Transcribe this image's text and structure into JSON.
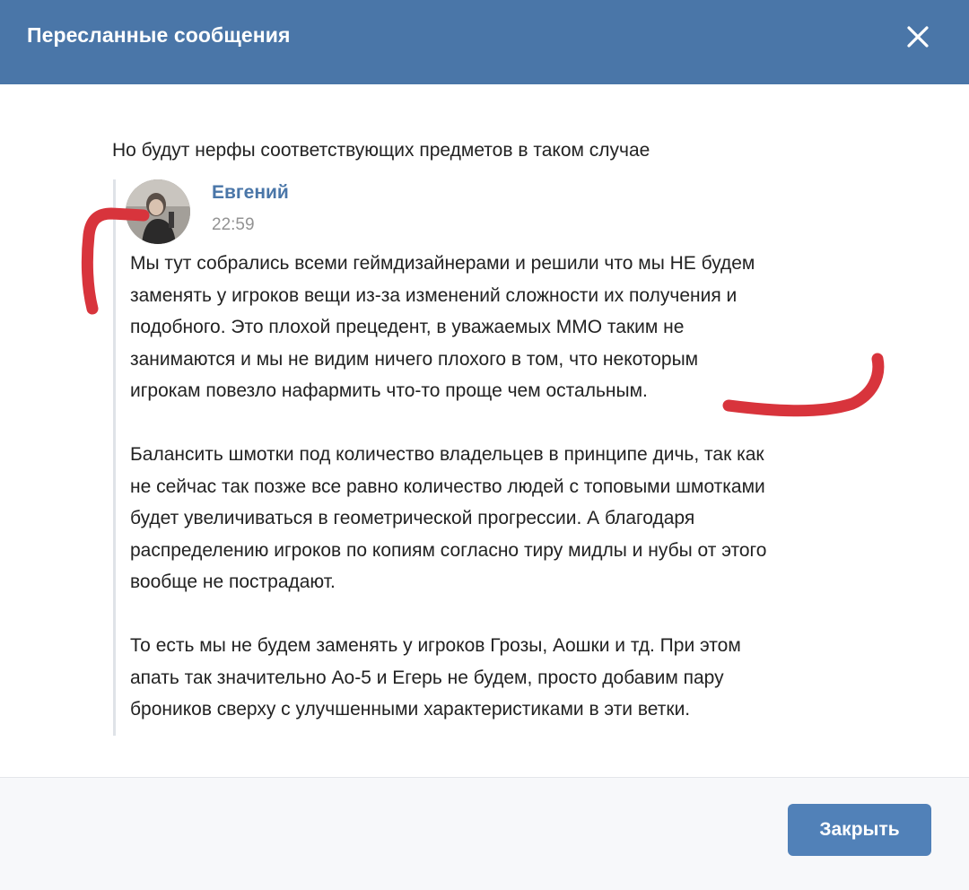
{
  "header": {
    "title": "Пересланные сообщения",
    "close_icon": "close-icon"
  },
  "message": {
    "text": "Но будут нерфы соответствующих предметов в таком случае"
  },
  "forwarded": {
    "author": "Евгений",
    "time": "22:59",
    "paragraphs": [
      {
        "lines": [
          "Мы тут собрались всеми геймдизайнерами и решили что мы НЕ будем",
          "заменять у игроков вещи из-за изменений сложности их получения и",
          "подобного. Это плохой прецедент, в уважаемых ММО таким не",
          "занимаются и мы не видим ничего плохого в том, что некоторым",
          "игрокам повезло нафармить что-то проще чем остальным."
        ]
      },
      {
        "lines": [
          "Балансить шмотки под количество владельцев в принципе дичь, так как",
          "не сейчас так позже все равно количество людей с топовыми шмотками",
          "будет увеличиваться в геометрической прогрессии. А благодаря",
          "распределению игроков по копиям согласно тиру мидлы и нубы от этого",
          "вообще не пострадают."
        ]
      },
      {
        "lines": [
          "То есть мы не будем заменять у игроков Грозы, Аошки и тд. При этом",
          "апать так значительно Ао-5 и Егерь не будем, просто добавим пару",
          "броников сверху с улучшенными характеристиками в эти ветки."
        ]
      }
    ]
  },
  "footer": {
    "close_label": "Закрыть"
  },
  "colors": {
    "header_bg": "#4a76a8",
    "author_link": "#4a76a8",
    "button_bg": "#5181b8",
    "annotation": "#d8343c"
  }
}
